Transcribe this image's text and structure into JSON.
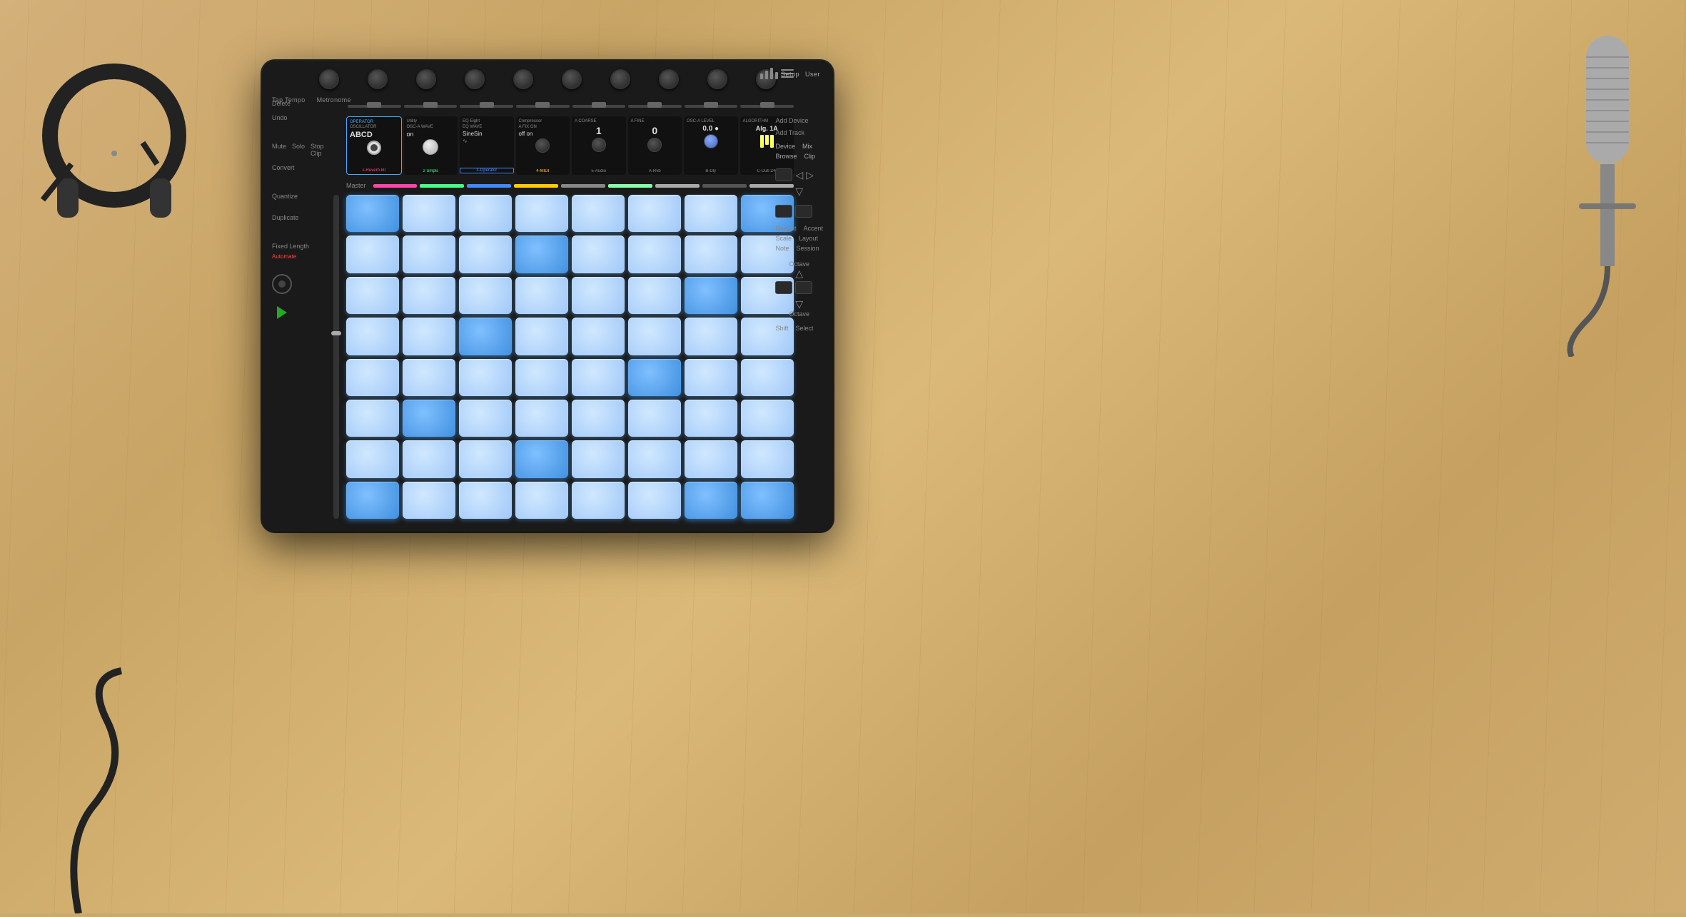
{
  "table": {
    "bg_color": "#c8a96e"
  },
  "controller": {
    "bg_color": "#1a1a1a"
  },
  "top_controls": {
    "tap_tempo": "Tap Tempo",
    "metronome": "Metronome",
    "setup": "Setup",
    "user": "User"
  },
  "left_buttons": {
    "delete": "Delete",
    "undo": "Undo",
    "mute": "Mute",
    "solo": "Solo",
    "stop_clip": "Stop\nClip",
    "convert": "Convert",
    "quantize": "Quantize",
    "duplicate": "Duplicate",
    "fixed_length": "Fixed\nLength",
    "automate": "Automate"
  },
  "right_buttons": {
    "add_device": "Add\nDevice",
    "add_track": "Add\nTrack",
    "device": "Device",
    "mix": "Mix",
    "browse": "Browse",
    "clip": "Clip",
    "master": "Master",
    "repeat": "Repeat",
    "accent": "Accent",
    "scale": "Scale",
    "layout": "Layout",
    "note": "Note",
    "session": "Session",
    "octave_up": "Octave",
    "octave_down": "Octave",
    "shift": "Shift",
    "select": "Select"
  },
  "device_panels": [
    {
      "id": 1,
      "type": "Operator",
      "title": "OSCILLATOR",
      "wave": "OSC-A WAVE",
      "value": "ABCD",
      "label": "1-Reverb 80",
      "color": "#ff4488",
      "active": true
    },
    {
      "id": 2,
      "type": "Utility",
      "title": "OSC-A WAVE",
      "value": "on",
      "label": "2 Smpls",
      "color": "#44ff88",
      "active": false
    },
    {
      "id": 3,
      "type": "EQ Eight",
      "title": "EQ WAVE",
      "value": "SineSin",
      "label": "3-Operator",
      "color": "#4488ff",
      "active": false
    },
    {
      "id": 4,
      "type": "Compressor",
      "title": "A FIX ON",
      "value": "off on",
      "label": "4-MIDI",
      "color": "#ffcc00",
      "active": false
    },
    {
      "id": 5,
      "type": "A COARSE",
      "title": "A COARSE",
      "value": "1",
      "label": "5-Audio",
      "color": "#888",
      "active": false
    },
    {
      "id": 6,
      "type": "A FINE",
      "title": "A FINE",
      "value": "0",
      "label": "A-Rvb",
      "color": "#888",
      "active": false
    },
    {
      "id": 7,
      "type": "OSC-A LEVEL",
      "title": "OSC-A LEVEL",
      "value": "0.0",
      "label": "B-Dly",
      "color": "#888",
      "active": false
    },
    {
      "id": 8,
      "type": "ALGORITHM",
      "title": "ALGORITHM",
      "value": "Alg. 1A",
      "label": "C-Dub Dly",
      "color": "#888",
      "active": false
    }
  ],
  "track_colors": [
    "#ff44aa",
    "#44ff88",
    "#4488ff",
    "#ffcc00",
    "#888888",
    "#88ffaa",
    "#aaaaaa",
    "#444444",
    "#aaaaaa"
  ],
  "pad_grid": {
    "rows": 8,
    "cols": 8,
    "lit_blue_positions": [
      [
        0,
        0
      ],
      [
        0,
        7
      ],
      [
        1,
        3
      ],
      [
        2,
        6
      ],
      [
        3,
        2
      ],
      [
        4,
        5
      ],
      [
        5,
        1
      ],
      [
        6,
        3
      ],
      [
        7,
        0
      ],
      [
        7,
        6
      ],
      [
        7,
        7
      ]
    ]
  }
}
